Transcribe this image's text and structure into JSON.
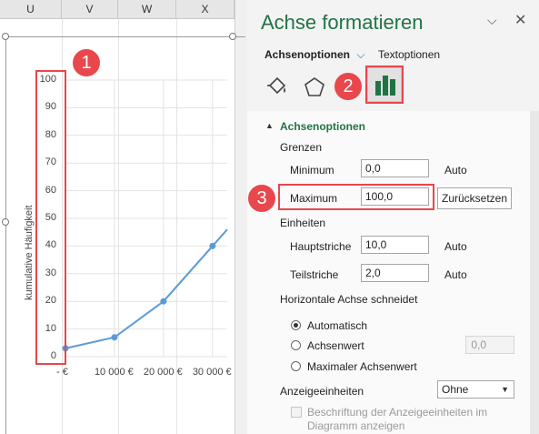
{
  "spreadsheet": {
    "columns": [
      "U",
      "V",
      "W",
      "X"
    ]
  },
  "chart_data": {
    "type": "line",
    "ylabel": "kumulative Häufigkeit",
    "yticks": [
      "100",
      "90",
      "80",
      "70",
      "60",
      "50",
      "40",
      "30",
      "20",
      "10",
      "0"
    ],
    "ylim": [
      0,
      100
    ],
    "xtick_labels": [
      "-  €",
      "10 000 €",
      "20 000 €",
      "30 000 €"
    ],
    "xlim": [
      0,
      33000
    ],
    "series": [
      {
        "x": [
          0,
          10000,
          20000,
          30000,
          33000
        ],
        "y": [
          3,
          7,
          20,
          40,
          46
        ]
      }
    ],
    "grid": true,
    "color": "#5b9bd5"
  },
  "pane": {
    "title": "Achse formatieren",
    "tab_options": "Achsenoptionen",
    "tab_text": "Textoptionen",
    "section_title": "Achsenoptionen",
    "bounds_heading": "Grenzen",
    "minimum_label": "Minimum",
    "minimum_value": "0,0",
    "minimum_status": "Auto",
    "maximum_label": "Maximum",
    "maximum_value": "100,0",
    "reset_button": "Zurücksetzen",
    "units_heading": "Einheiten",
    "major_label": "Hauptstriche",
    "major_value": "10,0",
    "major_status": "Auto",
    "minor_label": "Teilstriche",
    "minor_value": "2,0",
    "minor_status": "Auto",
    "cross_heading": "Horizontale Achse schneidet",
    "radio_auto": "Automatisch",
    "radio_value": "Achsenwert",
    "radio_value_field": "0,0",
    "radio_max": "Maximaler Achsenwert",
    "display_units_label": "Anzeigeeinheiten",
    "display_units_value": "Ohne",
    "show_label_line1": "Beschriftung der Anzeigeeinheiten im",
    "show_label_line2": "Diagramm anzeigen"
  },
  "callouts": [
    "1",
    "2",
    "3"
  ],
  "colors": {
    "accent": "#217346",
    "callout": "#e8474c",
    "series": "#5b9bd5"
  }
}
